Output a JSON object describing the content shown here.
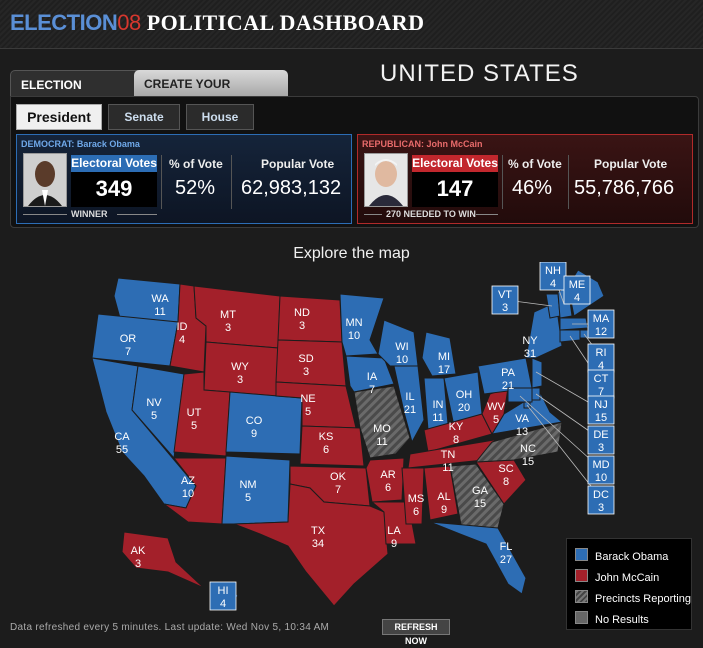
{
  "header": {
    "logo_election": "ELECTION",
    "logo_year": "08",
    "title": "POLITICAL DASHBOARD"
  },
  "tabs": {
    "results": "ELECTION RESULTS",
    "scenario": "CREATE YOUR SCENARIO"
  },
  "region_title": "UNITED STATES",
  "race_buttons": {
    "president": "President",
    "senate": "Senate",
    "house": "House"
  },
  "democrat": {
    "party_label": "DEMOCRAT: Barack Obama",
    "ev_header": "Electoral Votes",
    "electoral_votes": "349",
    "pct_header": "% of Vote",
    "pct": "52%",
    "pop_header": "Popular Vote",
    "popular": "62,983,132",
    "status": "WINNER"
  },
  "republican": {
    "party_label": "REPUBLICAN: John McCain",
    "ev_header": "Electoral Votes",
    "electoral_votes": "147",
    "pct_header": "% of Vote",
    "pct": "46%",
    "pop_header": "Popular Vote",
    "popular": "55,786,766",
    "needed": "270 NEEDED TO WIN"
  },
  "map_title": "Explore the map",
  "colors": {
    "obama": "#2d6db4",
    "mccain": "#a3202a",
    "reporting": "#555555",
    "no_results": "#666666"
  },
  "states": [
    {
      "abbr": "WA",
      "ev": "11",
      "w": "obama"
    },
    {
      "abbr": "OR",
      "ev": "7",
      "w": "obama"
    },
    {
      "abbr": "CA",
      "ev": "55",
      "w": "obama"
    },
    {
      "abbr": "NV",
      "ev": "5",
      "w": "obama"
    },
    {
      "abbr": "ID",
      "ev": "4",
      "w": "mccain"
    },
    {
      "abbr": "MT",
      "ev": "3",
      "w": "mccain"
    },
    {
      "abbr": "WY",
      "ev": "3",
      "w": "mccain"
    },
    {
      "abbr": "UT",
      "ev": "5",
      "w": "mccain"
    },
    {
      "abbr": "AZ",
      "ev": "10",
      "w": "mccain"
    },
    {
      "abbr": "CO",
      "ev": "9",
      "w": "obama"
    },
    {
      "abbr": "NM",
      "ev": "5",
      "w": "obama"
    },
    {
      "abbr": "ND",
      "ev": "3",
      "w": "mccain"
    },
    {
      "abbr": "SD",
      "ev": "3",
      "w": "mccain"
    },
    {
      "abbr": "NE",
      "ev": "5",
      "w": "mccain"
    },
    {
      "abbr": "KS",
      "ev": "6",
      "w": "mccain"
    },
    {
      "abbr": "OK",
      "ev": "7",
      "w": "mccain"
    },
    {
      "abbr": "TX",
      "ev": "34",
      "w": "mccain"
    },
    {
      "abbr": "MN",
      "ev": "10",
      "w": "obama"
    },
    {
      "abbr": "IA",
      "ev": "7",
      "w": "obama"
    },
    {
      "abbr": "MO",
      "ev": "11",
      "w": "reporting"
    },
    {
      "abbr": "AR",
      "ev": "6",
      "w": "mccain"
    },
    {
      "abbr": "LA",
      "ev": "9",
      "w": "mccain"
    },
    {
      "abbr": "WI",
      "ev": "10",
      "w": "obama"
    },
    {
      "abbr": "IL",
      "ev": "21",
      "w": "obama"
    },
    {
      "abbr": "MI",
      "ev": "17",
      "w": "obama"
    },
    {
      "abbr": "IN",
      "ev": "11",
      "w": "obama"
    },
    {
      "abbr": "OH",
      "ev": "20",
      "w": "obama"
    },
    {
      "abbr": "KY",
      "ev": "8",
      "w": "mccain"
    },
    {
      "abbr": "TN",
      "ev": "11",
      "w": "mccain"
    },
    {
      "abbr": "MS",
      "ev": "6",
      "w": "mccain"
    },
    {
      "abbr": "AL",
      "ev": "9",
      "w": "mccain"
    },
    {
      "abbr": "GA",
      "ev": "15",
      "w": "reporting"
    },
    {
      "abbr": "FL",
      "ev": "27",
      "w": "obama"
    },
    {
      "abbr": "SC",
      "ev": "8",
      "w": "mccain"
    },
    {
      "abbr": "NC",
      "ev": "15",
      "w": "reporting"
    },
    {
      "abbr": "VA",
      "ev": "13",
      "w": "obama"
    },
    {
      "abbr": "WV",
      "ev": "5",
      "w": "mccain"
    },
    {
      "abbr": "PA",
      "ev": "21",
      "w": "obama"
    },
    {
      "abbr": "NY",
      "ev": "31",
      "w": "obama"
    },
    {
      "abbr": "VT",
      "ev": "3",
      "w": "obama"
    },
    {
      "abbr": "NH",
      "ev": "4",
      "w": "obama"
    },
    {
      "abbr": "ME",
      "ev": "4",
      "w": "obama"
    },
    {
      "abbr": "MA",
      "ev": "12",
      "w": "obama"
    },
    {
      "abbr": "RI",
      "ev": "4",
      "w": "obama"
    },
    {
      "abbr": "CT",
      "ev": "7",
      "w": "obama"
    },
    {
      "abbr": "NJ",
      "ev": "15",
      "w": "obama"
    },
    {
      "abbr": "DE",
      "ev": "3",
      "w": "obama"
    },
    {
      "abbr": "MD",
      "ev": "10",
      "w": "obama"
    },
    {
      "abbr": "DC",
      "ev": "3",
      "w": "obama"
    },
    {
      "abbr": "AK",
      "ev": "3",
      "w": "mccain"
    },
    {
      "abbr": "HI",
      "ev": "4",
      "w": "obama"
    }
  ],
  "legend": {
    "obama": "Barack Obama",
    "mccain": "John McCain",
    "reporting": "Precincts Reporting",
    "none": "No Results"
  },
  "footer": {
    "refreshed": "Data refreshed every 5 minutes. Last update: Wed Nov 5, 10:34 AM",
    "refresh_button": "REFRESH NOW"
  }
}
